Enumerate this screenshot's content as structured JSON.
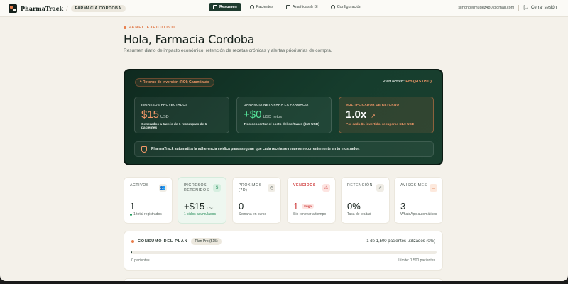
{
  "brand": {
    "name": "PharmaTrack",
    "pharmacy": "FARMACIA CORDOBA"
  },
  "nav": {
    "tabs": [
      {
        "label": "Resumen",
        "icon": "grid-icon",
        "active": true
      },
      {
        "label": "Pacientes",
        "icon": "user-icon",
        "active": false
      },
      {
        "label": "Analíticas & BI",
        "icon": "chart-icon",
        "active": false
      },
      {
        "label": "Configuración",
        "icon": "gear-icon",
        "active": false
      }
    ],
    "user_email": "simonbermudez480@gmail.com",
    "logout_label": "Cerrar sesión"
  },
  "header": {
    "eyebrow": "PANEL EJECUTIVO",
    "greeting": "Hola, Farmacia Cordoba",
    "subtitle": "Resumen diario de impacto económico, retención de recetas crónicas y alertas prioritarias de compra."
  },
  "hero": {
    "roi_label": "Retorno de Inversión (ROI) Garantizado",
    "plan_prefix": "Plan activo:",
    "plan_value": "Pro ($15 USD)",
    "metrics": [
      {
        "label": "INGRESOS PROYECTADOS",
        "value": "$15",
        "unit": "USD",
        "desc": "Generados a través de 1 recompras de 1 pacientes"
      },
      {
        "label": "GANANCIA NETA PARA LA FARMACIA",
        "value": "+$0",
        "unit": "USD netos",
        "desc": "Tras descontar el costo del software ($15 USD)"
      },
      {
        "label": "MULTIPLICADOR DE RETORNO",
        "value": "1.0x",
        "unit": "",
        "desc": "Por cada $1 invertido, recuperas $1.0 USD"
      }
    ],
    "note": "PharmaTrack automatiza la adherencia médica para asegurar que cada receta se renueve recurrentemente en tu mostrador."
  },
  "stats": [
    {
      "label": "ACTIVOS",
      "icon": "users-icon",
      "value": "1",
      "unit": "",
      "sub": "1 total registrados",
      "variant": "plain"
    },
    {
      "label": "INGRESOS RETENIDOS",
      "icon": "dollar-icon",
      "value": "+$15",
      "unit": "USD",
      "sub": "1 ciclos acumulados",
      "variant": "green"
    },
    {
      "label": "PRÓXIMOS (7D)",
      "icon": "clock-icon",
      "value": "0",
      "unit": "",
      "sub": "Semana en curso",
      "variant": "plain"
    },
    {
      "label": "VENCIDOS",
      "icon": "warning-icon",
      "value": "1",
      "tag": "Fuga",
      "sub": "Sin renovar a tiempo",
      "variant": "red"
    },
    {
      "label": "RETENCIÓN",
      "icon": "trend-icon",
      "value": "0%",
      "unit": "",
      "sub": "Tasa de lealtad",
      "variant": "plain"
    },
    {
      "label": "AVISOS MES",
      "icon": "message-icon",
      "value": "3",
      "unit": "",
      "sub": "WhatsApp automáticos",
      "variant": "orange"
    }
  ],
  "usage": {
    "title": "CONSUMO DEL PLAN",
    "plan_pill": "Plan Pro ($15)",
    "count_text": "1 de 1,500 pacientes utilizados (0%)",
    "progress_fraction": 0.0007,
    "left_label": "0 pacientes",
    "right_label": "Límite: 1,500 pacientes"
  },
  "colors": {
    "accent": "#e87d4a",
    "brand_dark": "#1e3a2e",
    "positive": "#55e39a",
    "danger": "#d04040"
  }
}
